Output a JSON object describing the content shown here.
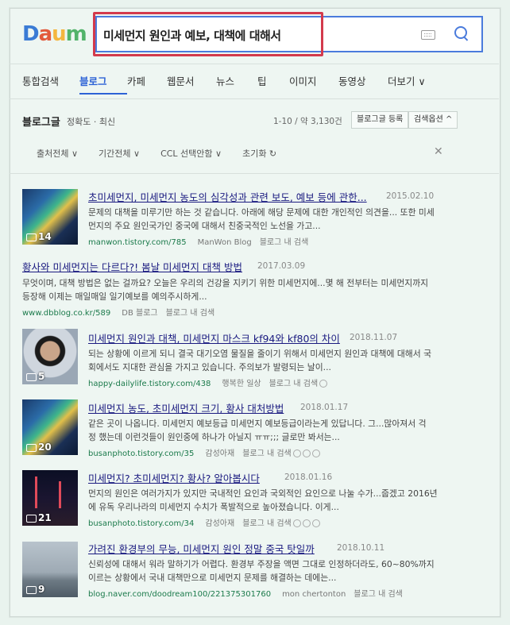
{
  "logo": {
    "letters": [
      "D",
      "a",
      "u",
      "m"
    ],
    "colors": [
      "#3a7bd5",
      "#e25a3c",
      "#f4b63f",
      "#52b36a"
    ]
  },
  "search": {
    "query": "미세먼지 원인과 예보, 대책에 대해서"
  },
  "nav": [
    "통합검색",
    "블로그",
    "카페",
    "웹문서",
    "뉴스",
    "팁",
    "이미지",
    "동영상",
    "더보기 ∨"
  ],
  "section": {
    "title": "블로그글",
    "sort": "정확도 · 최신",
    "count": "1-10 / 약 3,130건",
    "register_btn": "블로그글 등록",
    "options_btn": "검색옵션 ^"
  },
  "filters": [
    "출처전체 ∨",
    "기간전체 ∨",
    "CCL 선택안함 ∨",
    "초기화 ↻"
  ],
  "results": [
    {
      "title": "초미세먼지, 미세먼지 농도의 심각성과 관련 보도, 예보 등에 관한...",
      "date": "2015.02.10",
      "desc": "문제의 대책을 미루기만 하는 것 같습니다. 아래에 해당 문제에 대한 개인적인 의견을... 또한 미세\n먼지의 주요 원인국가인 중국에 대해서 친중국적인 노선을 가고...",
      "url": "manwon.tistory.com/785",
      "blog": "ManWon Blog",
      "search_in": "블로그 내 검색",
      "photo_count": "14"
    },
    {
      "title": "황사와 미세먼지는 다르다?! 봄날 미세먼지 대책 방법",
      "date": "2017.03.09",
      "desc": "무엇이며, 대책 방법은 없는 걸까요? 오늘은 우리의 건강을 지키기 위한 미세먼지에...몇 해 전부터는 미세먼지까지\n등장해 이제는 매일매일 일기예보를 예의주시하게...",
      "url": "www.dbblog.co.kr/589",
      "blog": "DB 블로그",
      "search_in": "블로그 내 검색"
    },
    {
      "title": "미세먼지 원인과 대책, 미세먼지 마스크 kf94와 kf80의 차이",
      "date": "2018.11.07",
      "desc": "되는 상황에 이르게 되니 결국 대기오염 물질을 줄이기 위해서 미세먼지 원인과 대책에 대해서 국\n회에서도 지대한 관심을 가지고 있습니다. 주의보가 발령되는 날이...",
      "url": "happy-dailylife.tistory.com/438",
      "blog": "행복한 일상",
      "search_in": "블로그 내 검색",
      "photo_count": "5"
    },
    {
      "title": "미세먼지 농도, 초미세먼지 크기, 황사 대처방법",
      "date": "2018.01.17",
      "desc": "같은 곳이 나옵니다. 미세먼지 예보등급 미세먼지 예보등급이라는게 있답니다. 그...많아져서 걱\n정 했는데 이런것들이 원인중에 하나가 아닐지 ㅠㅠ;;; 글로만 봐서는...",
      "url": "busanphoto.tistory.com/35",
      "blog": "감성아재",
      "search_in": "블로그 내 검색",
      "photo_count": "20"
    },
    {
      "title": "미세먼지? 초미세먼지? 황사? 알아봅시다",
      "date": "2018.01.16",
      "desc": "먼지의 원인은 여러가지가 있지만 국내적인 요인과 국외적인 요인으로 나눌 수가...줍겠고 2016년\n에 유독 우리나라의 미세먼지 수치가 폭발적으로 높아졌습니다. 이게...",
      "url": "busanphoto.tistory.com/34",
      "blog": "감성아재",
      "search_in": "블로그 내 검색",
      "photo_count": "21"
    },
    {
      "title": "가려진 환경부의 무능, 미세먼지 원인 정말 중국 탓일까",
      "date": "2018.10.11",
      "desc": "신뢰성에 대해서 워라 말하기가 어렵다. 환경부 주장을 액면 그대로 인정하더라도, 60~80%까지\n이르는 상황에서 국내 대책만으로 미세먼지 문제를 해결하는 데에는...",
      "url": "blog.naver.com/doodream100/221375301760",
      "blog": "mon chertonton",
      "search_in": "블로그 내 검색",
      "photo_count": "9"
    }
  ]
}
